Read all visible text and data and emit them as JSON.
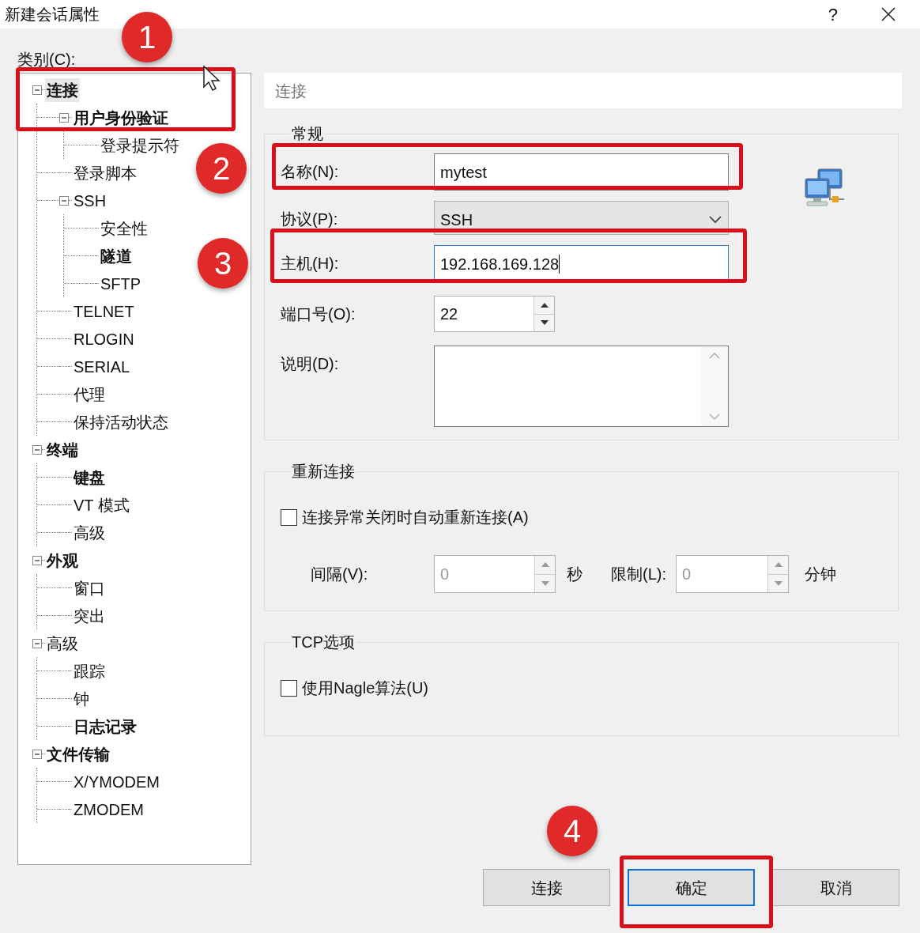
{
  "window": {
    "title": "新建会话属性",
    "help": "?"
  },
  "category_label": "类别(C):",
  "tree": [
    {
      "label": "连接",
      "bold": true,
      "selected": true,
      "expanded": true,
      "children": [
        {
          "label": "用户身份验证",
          "bold": true,
          "selected": false,
          "expanded": true,
          "children": [
            {
              "label": "登录提示符",
              "bold": false,
              "selected": false
            }
          ]
        },
        {
          "label": "登录脚本",
          "bold": false,
          "selected": false
        },
        {
          "label": "SSH",
          "bold": false,
          "selected": false,
          "expanded": true,
          "children": [
            {
              "label": "安全性",
              "bold": false,
              "selected": false
            },
            {
              "label": "隧道",
              "bold": true,
              "selected": false
            },
            {
              "label": "SFTP",
              "bold": false,
              "selected": false
            }
          ]
        },
        {
          "label": "TELNET",
          "bold": false,
          "selected": false
        },
        {
          "label": "RLOGIN",
          "bold": false,
          "selected": false
        },
        {
          "label": "SERIAL",
          "bold": false,
          "selected": false
        },
        {
          "label": "代理",
          "bold": false,
          "selected": false
        },
        {
          "label": "保持活动状态",
          "bold": false,
          "selected": false
        }
      ]
    },
    {
      "label": "终端",
      "bold": true,
      "selected": false,
      "expanded": true,
      "children": [
        {
          "label": "键盘",
          "bold": true,
          "selected": false
        },
        {
          "label": "VT 模式",
          "bold": false,
          "selected": false
        },
        {
          "label": "高级",
          "bold": false,
          "selected": false
        }
      ]
    },
    {
      "label": "外观",
      "bold": true,
      "selected": false,
      "expanded": true,
      "children": [
        {
          "label": "窗口",
          "bold": false,
          "selected": false
        },
        {
          "label": "突出",
          "bold": false,
          "selected": false
        }
      ]
    },
    {
      "label": "高级",
      "bold": false,
      "selected": false,
      "expanded": true,
      "children": [
        {
          "label": "跟踪",
          "bold": false,
          "selected": false
        },
        {
          "label": "钟",
          "bold": false,
          "selected": false
        },
        {
          "label": "日志记录",
          "bold": true,
          "selected": false
        }
      ]
    },
    {
      "label": "文件传输",
      "bold": true,
      "selected": false,
      "expanded": true,
      "children": [
        {
          "label": "X/YMODEM",
          "bold": false,
          "selected": false
        },
        {
          "label": "ZMODEM",
          "bold": false,
          "selected": false
        }
      ]
    }
  ],
  "header": "连接",
  "general": {
    "title": "常规",
    "fields": [
      {
        "kind": "text",
        "label": "名称(N):",
        "value": "mytest",
        "focused": false
      },
      {
        "kind": "select",
        "label": "协议(P):",
        "value": "SSH"
      },
      {
        "kind": "text",
        "label": "主机(H):",
        "value": "192.168.169.128",
        "focused": true
      },
      {
        "kind": "spinner",
        "label": "端口号(O):",
        "value": "22"
      },
      {
        "kind": "textarea",
        "label": "说明(D):"
      }
    ]
  },
  "reconnect": {
    "title": "重新连接",
    "checkbox": {
      "label": "连接异常关闭时自动重新连接(A)",
      "checked": false
    },
    "spinners": [
      {
        "label": "间隔(V):",
        "value": "0",
        "unit": "秒",
        "disabled": true
      },
      {
        "label": "限制(L):",
        "value": "0",
        "unit": "分钟",
        "disabled": true
      }
    ]
  },
  "tcp": {
    "title": "TCP选项",
    "checkbox": {
      "label": "使用Nagle算法(U)",
      "checked": false
    }
  },
  "buttons": [
    {
      "label": "连接",
      "default": false
    },
    {
      "label": "确定",
      "default": true
    },
    {
      "label": "取消",
      "default": false
    }
  ],
  "callouts": [
    "1",
    "2",
    "3",
    "4"
  ]
}
